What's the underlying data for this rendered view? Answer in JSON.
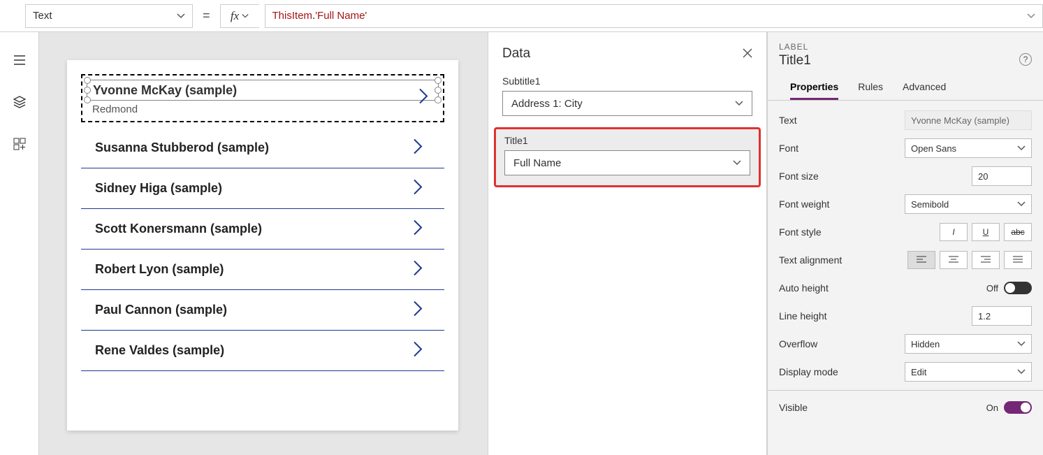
{
  "formula_bar": {
    "property": "Text",
    "equals": "=",
    "tok_obj": "ThisItem",
    "tok_dot": ".",
    "tok_field": "'Full Name'"
  },
  "preview": {
    "selected": {
      "title": "Yvonne McKay (sample)",
      "subtitle": "Redmond"
    },
    "items": [
      "Susanna Stubberod (sample)",
      "Sidney Higa (sample)",
      "Scott Konersmann (sample)",
      "Robert Lyon (sample)",
      "Paul Cannon (sample)",
      "Rene Valdes (sample)"
    ]
  },
  "data_panel": {
    "title": "Data",
    "subtitle1_label": "Subtitle1",
    "subtitle1_value": "Address 1: City",
    "title1_label": "Title1",
    "title1_value": "Full Name"
  },
  "props_panel": {
    "kind": "LABEL",
    "name": "Title1",
    "tabs": {
      "properties": "Properties",
      "rules": "Rules",
      "advanced": "Advanced"
    },
    "rows": {
      "text_label": "Text",
      "text_value": "Yvonne McKay (sample)",
      "font_label": "Font",
      "font_value": "Open Sans",
      "font_size_label": "Font size",
      "font_size_value": "20",
      "font_weight_label": "Font weight",
      "font_weight_value": "Semibold",
      "font_style_label": "Font style",
      "text_align_label": "Text alignment",
      "auto_height_label": "Auto height",
      "auto_height_state": "Off",
      "line_height_label": "Line height",
      "line_height_value": "1.2",
      "overflow_label": "Overflow",
      "overflow_value": "Hidden",
      "display_mode_label": "Display mode",
      "display_mode_value": "Edit",
      "visible_label": "Visible",
      "visible_state": "On"
    },
    "style_buttons": {
      "italic": "I",
      "underline": "U",
      "strike": "abc"
    }
  }
}
